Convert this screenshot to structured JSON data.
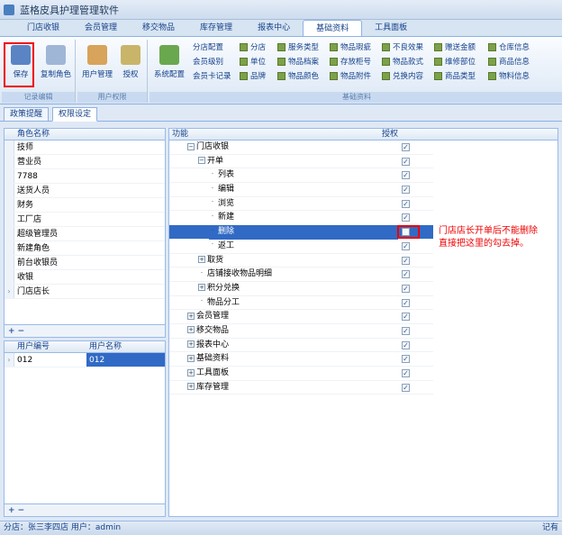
{
  "app": {
    "title": "蓝格皮具护理管理软件"
  },
  "menu_tabs": [
    "门店收银",
    "会员管理",
    "移交物品",
    "库存管理",
    "报表中心",
    "基础资料",
    "工具面板"
  ],
  "ribbon": {
    "save": "保存",
    "copy_role": "复制角色",
    "user_mgmt": "用户管理",
    "authorize": "授权",
    "sys_config": "系统配置",
    "group_edit": "记录编辑",
    "group_perm": "用户权限",
    "group_base": "基础资料",
    "items": [
      [
        "分店配置",
        "分店",
        "服务类型",
        "物品瑕疵",
        "不良效果",
        "赠送金额",
        "仓库信息"
      ],
      [
        "会员级别",
        "单位",
        "物品档案",
        "存放柜号",
        "物品款式",
        "维修部位",
        "商品信息"
      ],
      [
        "会员卡记录",
        "品牌",
        "物品颜色",
        "物品附件",
        "兑换内容",
        "商品类型",
        "物料信息"
      ]
    ]
  },
  "subtabs": [
    "政策提醒",
    "权限设定"
  ],
  "roles": {
    "header": "角色名称",
    "items": [
      "技师",
      "营业员",
      "7788",
      "送货人员",
      "财务",
      "工厂店",
      "超级管理员",
      "新建角色",
      "前台收银员",
      "收银",
      "门店店长"
    ]
  },
  "users": {
    "headers": [
      "用户编号",
      "用户名称"
    ],
    "rows": [
      [
        "012",
        "012"
      ]
    ]
  },
  "perm": {
    "headers": [
      "功能",
      "授权"
    ],
    "rows": [
      {
        "label": "门店收银",
        "level": 0,
        "expander": "−"
      },
      {
        "label": "开单",
        "level": 1,
        "expander": "−"
      },
      {
        "label": "列表",
        "level": 2,
        "expander": ""
      },
      {
        "label": "编辑",
        "level": 2,
        "expander": ""
      },
      {
        "label": "浏览",
        "level": 2,
        "expander": ""
      },
      {
        "label": "新建",
        "level": 2,
        "expander": ""
      },
      {
        "label": "删除",
        "level": 2,
        "expander": "",
        "selected": true,
        "unchecked": true
      },
      {
        "label": "返工",
        "level": 2,
        "expander": ""
      },
      {
        "label": "取货",
        "level": 1,
        "expander": "+"
      },
      {
        "label": "店铺接收物品明细",
        "level": 1,
        "expander": ""
      },
      {
        "label": "积分兑换",
        "level": 1,
        "expander": "+"
      },
      {
        "label": "物品分工",
        "level": 1,
        "expander": ""
      },
      {
        "label": "会员管理",
        "level": 0,
        "expander": "+"
      },
      {
        "label": "移交物品",
        "level": 0,
        "expander": "+"
      },
      {
        "label": "报表中心",
        "level": 0,
        "expander": "+"
      },
      {
        "label": "基础资料",
        "level": 0,
        "expander": "+"
      },
      {
        "label": "工具面板",
        "level": 0,
        "expander": "+"
      },
      {
        "label": "库存管理",
        "level": 0,
        "expander": "+"
      }
    ]
  },
  "annotation": [
    "门店店长开单后不能删除",
    "直接把这里的勾去掉。"
  ],
  "status": {
    "text": "分店：张三李四店  用户：admin",
    "right": "记有"
  }
}
